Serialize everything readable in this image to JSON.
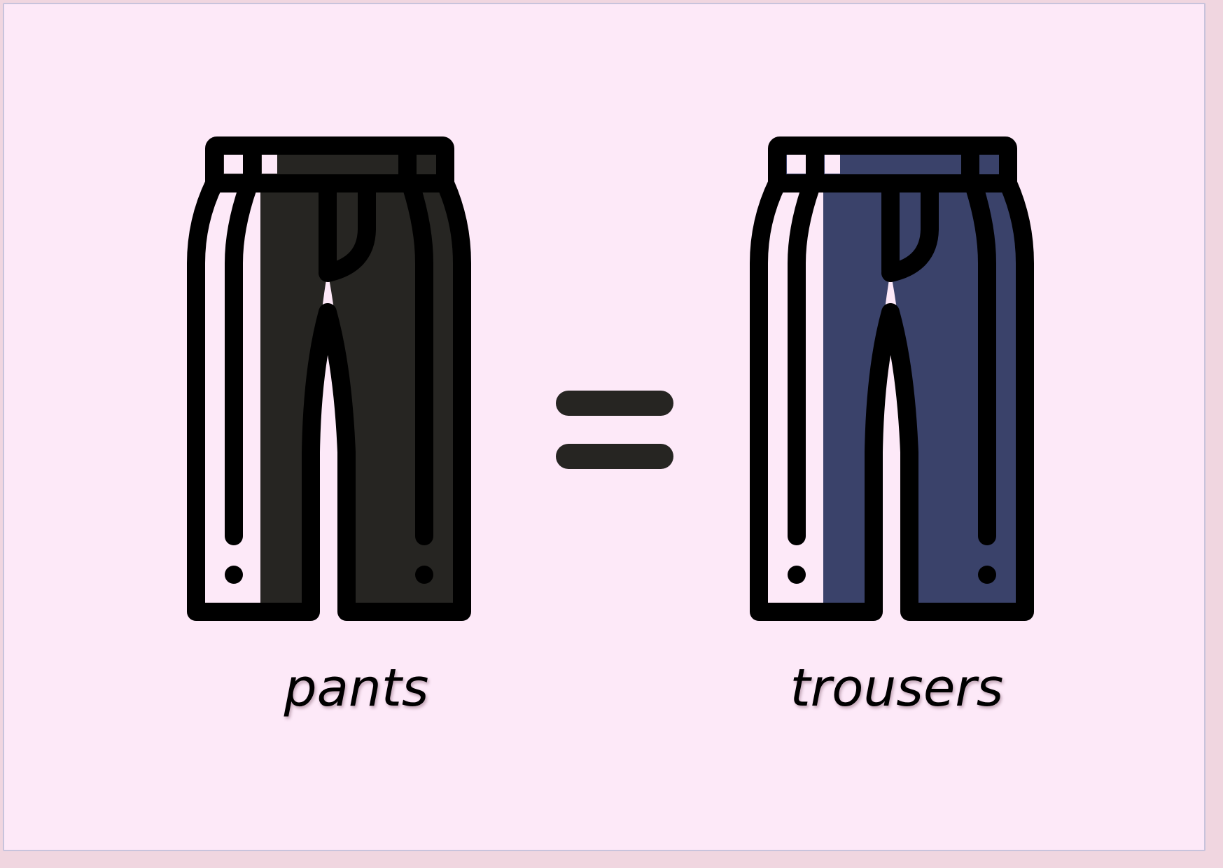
{
  "colors": {
    "background": "#fde9f8",
    "card_border": "#c8c3dc",
    "outline": "#000000",
    "left_pants_fill": "#262522",
    "right_pants_fill": "#3a426a",
    "equals_sign": "#262522"
  },
  "left_item": {
    "icon": "pants-icon",
    "label": "pants"
  },
  "operator": {
    "icon": "equals-icon"
  },
  "right_item": {
    "icon": "trousers-icon",
    "label": "trousers"
  }
}
